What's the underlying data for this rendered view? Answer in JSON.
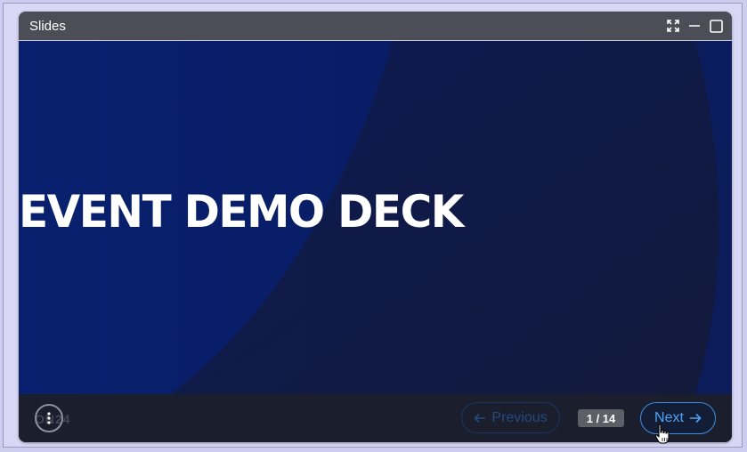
{
  "window": {
    "title": "Slides",
    "controls": [
      "fullscreen-icon",
      "minimize-icon",
      "maximize-icon"
    ]
  },
  "slide": {
    "title": "EVENT DEMO DECK"
  },
  "controls": {
    "menu_icon": "more-vertical-icon",
    "watermark": "ON24",
    "previous_label": "Previous",
    "next_label": "Next",
    "page_indicator": "1 / 14",
    "current_page": 1,
    "total_pages": 14
  },
  "colors": {
    "titlebar": "#4b4d57",
    "slide_background": "#0a1c6e",
    "control_bar": "#1b1e2c",
    "next_accent": "#4ea3f5",
    "previous_disabled": "#244a80"
  }
}
